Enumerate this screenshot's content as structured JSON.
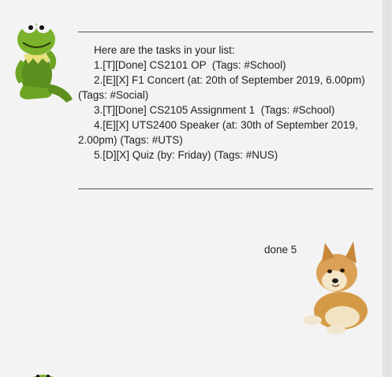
{
  "bot": {
    "header": "Here are the tasks in your list:",
    "tasks": [
      "1.[T][Done] CS2101 OP  (Tags: #School)",
      "2.[E][X] F1 Concert (at: 20th of September 2019, 6.00pm) (Tags: #Social)",
      "3.[T][Done] CS2105 Assignment 1  (Tags: #School)",
      "4.[E][X] UTS2400 Speaker (at: 30th of September 2019, 2.00pm) (Tags: #UTS)",
      "5.[D][X] Quiz (by: Friday) (Tags: #NUS)"
    ]
  },
  "user": {
    "message": "done 5"
  },
  "icons": {
    "bot_avatar": "kermit-frog-icon",
    "user_avatar": "shiba-dog-icon"
  }
}
